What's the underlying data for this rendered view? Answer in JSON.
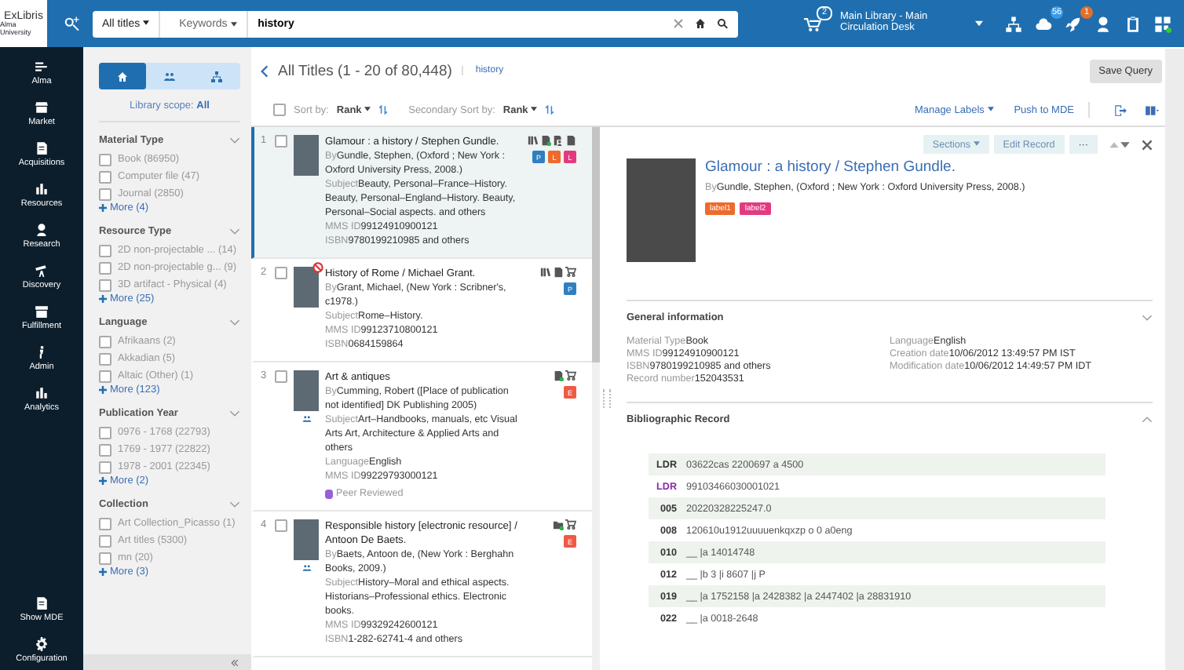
{
  "topbar": {
    "logo_brand": "ExLibris",
    "logo_sub": "Alma University",
    "scope": "All titles",
    "search_type": "Keywords",
    "query": "history",
    "cart_count": "2",
    "location": "Main Library - Main Circulation Desk",
    "tasks_count": "56",
    "alerts_count": "1"
  },
  "nav": [
    {
      "kind": "lines",
      "label": "Alma"
    },
    {
      "kind": "store",
      "label": "Market"
    },
    {
      "kind": "document",
      "label": "Acquisitions"
    },
    {
      "kind": "bars",
      "label": "Resources"
    },
    {
      "kind": "person",
      "label": "Research"
    },
    {
      "kind": "telescope",
      "label": "Discovery"
    },
    {
      "kind": "archive",
      "label": "Fulfillment"
    },
    {
      "kind": "admin",
      "label": "Admin"
    },
    {
      "kind": "bars",
      "label": "Analytics"
    }
  ],
  "nav_bottom": [
    {
      "kind": "document",
      "label": "Show MDE"
    },
    {
      "kind": "gear",
      "label": "Configuration"
    }
  ],
  "facets": {
    "tabs": [
      {
        "kind": "home",
        "selected": true
      },
      {
        "kind": "people",
        "selected": false
      },
      {
        "kind": "tree",
        "selected": false
      }
    ],
    "scope_label": "Library scope:",
    "scope_value": "All",
    "groups": [
      {
        "title": "Material Type",
        "options": [
          {
            "label": "Book (86950)",
            "checked": false
          },
          {
            "label": "Computer file (47)",
            "checked": false
          },
          {
            "label": "Journal (2850)",
            "checked": false
          }
        ],
        "more": "More (4)"
      },
      {
        "title": "Resource Type",
        "options": [
          {
            "label": "2D non-projectable ... (14)",
            "checked": false
          },
          {
            "label": "2D non-projectable g... (9)",
            "checked": false
          },
          {
            "label": "3D artifact - Physical (4)",
            "checked": false
          }
        ],
        "more": "More (25)"
      },
      {
        "title": "Language",
        "options": [
          {
            "label": "Afrikaans (2)",
            "checked": false
          },
          {
            "label": "Akkadian (5)",
            "checked": false
          },
          {
            "label": "Altaic (Other) (1)",
            "checked": false
          }
        ],
        "more": "More (123)"
      },
      {
        "title": "Publication Year",
        "options": [
          {
            "label": "0976 - 1768 (22793)",
            "checked": false
          },
          {
            "label": "1769 - 1977 (22822)",
            "checked": false
          },
          {
            "label": "1978 - 2001 (22345)",
            "checked": false
          }
        ],
        "more": "More (2)"
      },
      {
        "title": "Collection",
        "options": [
          {
            "label": "Art Collection_Picasso (1)",
            "checked": false
          },
          {
            "label": "Art titles (5300)",
            "checked": false
          },
          {
            "label": "mn (20)",
            "checked": false
          }
        ],
        "more": "More (3)"
      }
    ]
  },
  "header": {
    "select_all_checked": false,
    "title": "All Titles (1 - 20 of 80,448)",
    "query_tag": "history",
    "save_query": "Save Query",
    "sort_label": "Sort by:",
    "sort_value": "Rank",
    "secondary_label": "Secondary Sort by:",
    "secondary_value": "Rank",
    "manage_labels": "Manage Labels",
    "push_mde": "Push to MDE"
  },
  "results": [
    {
      "number": "1",
      "selected": true,
      "restricted": false,
      "shared": false,
      "title": "Glamour : a history / Stephen Gundle.",
      "by_label": "By",
      "by": "Gundle, Stephen, (Oxford ; New York : Oxford University Press, 2008.)",
      "fields": [
        {
          "label": "Subject",
          "value": "Beauty, Personal–France–History. Beauty, Personal–England–History. Beauty, Personal–Social aspects. and others"
        },
        {
          "label": "MMS ID",
          "value": "99124910900121"
        },
        {
          "label": "ISBN",
          "value": "9780199210985 and others"
        }
      ],
      "icons": [
        {
          "kind": "books"
        },
        {
          "kind": "doc-available"
        },
        {
          "kind": "doc-person"
        },
        {
          "kind": "doc"
        }
      ],
      "badges": [
        {
          "letter": "P",
          "color": "#2f7fc1"
        },
        {
          "letter": "L",
          "color": "#ee6a2c"
        },
        {
          "letter": "L",
          "color": "#e33a7f"
        }
      ]
    },
    {
      "number": "2",
      "selected": false,
      "restricted": true,
      "shared": false,
      "title": "History of Rome / Michael Grant.",
      "by_label": "By",
      "by": "Grant, Michael, (New York : Scribner's, c1978.)",
      "fields": [
        {
          "label": "Subject",
          "value": "Rome–History."
        },
        {
          "label": "MMS ID",
          "value": "99123710800121"
        },
        {
          "label": "ISBN",
          "value": "0684159864"
        }
      ],
      "icons": [
        {
          "kind": "books"
        },
        {
          "kind": "doc"
        },
        {
          "kind": "cart"
        }
      ],
      "badges": [
        {
          "letter": "P",
          "color": "#2f7fc1"
        }
      ]
    },
    {
      "number": "3",
      "selected": false,
      "restricted": false,
      "shared": true,
      "title": "Art & antiques",
      "by_label": "By",
      "by": "Cumming, Robert ([Place of publication not identified] DK Publishing 2005)",
      "fields": [
        {
          "label": "Subject",
          "value": "Art–Handbooks, manuals, etc Visual Arts Art, Architecture & Applied Arts and others"
        },
        {
          "label": "Language",
          "value": "English"
        },
        {
          "label": "MMS ID",
          "value": "99229793000121"
        }
      ],
      "peer_reviewed": "Peer Reviewed",
      "icons": [
        {
          "kind": "doc-available"
        },
        {
          "kind": "cart"
        }
      ],
      "badges": [
        {
          "letter": "E",
          "color": "#ee5a45"
        }
      ]
    },
    {
      "number": "4",
      "selected": false,
      "restricted": false,
      "shared": true,
      "title": "Responsible history [electronic resource] / Antoon De Baets.",
      "by_label": "By",
      "by": "Baets, Antoon de, (New York : Berghahn Books, 2009.)",
      "fields": [
        {
          "label": "Subject",
          "value": "History–Moral and ethical aspects. Historians–Professional ethics. Electronic books."
        },
        {
          "label": "MMS ID",
          "value": "99329242600121"
        },
        {
          "label": "ISBN",
          "value": "1-282-62741-4 and others"
        }
      ],
      "icons": [
        {
          "kind": "folder-available"
        },
        {
          "kind": "cart"
        }
      ],
      "badges": [
        {
          "letter": "E",
          "color": "#ee5a45"
        }
      ]
    }
  ],
  "detail": {
    "sections": "Sections",
    "edit_record": "Edit Record",
    "more": "···",
    "title": "Glamour : a history / Stephen Gundle.",
    "by_label": "By",
    "by": "Gundle, Stephen, (Oxford ; New York : Oxford University Press, 2008.)",
    "labels": [
      {
        "text": "label1",
        "color": "#ee6a2c"
      },
      {
        "text": "label2",
        "color": "#e33a7f"
      }
    ],
    "general_title": "General information",
    "general_left": [
      {
        "label": "Material Type",
        "value": "Book"
      },
      {
        "label": "MMS ID",
        "value": "99124910900121"
      },
      {
        "label": "ISBN",
        "value": "9780199210985 and others"
      },
      {
        "label": "Record number",
        "value": "152043531"
      }
    ],
    "general_right": [
      {
        "label": "Language",
        "value": "English"
      },
      {
        "label": "Creation date",
        "value": "10/06/2012 13:49:57 PM IST"
      },
      {
        "label": "Modification date",
        "value": "10/06/2012 14:49:57 PM IDT"
      }
    ],
    "bib_title": "Bibliographic Record",
    "bib_rows": [
      {
        "tag": "LDR",
        "value": "03622cas 2200697 a 4500",
        "highlighted": false
      },
      {
        "tag": "LDR",
        "value": "99103466030001021",
        "highlighted": true
      },
      {
        "tag": "005",
        "value": "20220328225247.0",
        "highlighted": false
      },
      {
        "tag": "008",
        "value": "120610u1912uuuuenkqxzp o 0 a0eng",
        "highlighted": false
      },
      {
        "tag": "010",
        "value": "__ |a 14014748",
        "highlighted": false
      },
      {
        "tag": "012",
        "value": "__ |b 3 |i 8607 |j P",
        "highlighted": false
      },
      {
        "tag": "019",
        "value": "__ |a 1752158 |a 2428382 |a 2447402 |a 28831910",
        "highlighted": false
      },
      {
        "tag": "022",
        "value": "__ |a 0018-2648",
        "highlighted": false
      }
    ]
  }
}
